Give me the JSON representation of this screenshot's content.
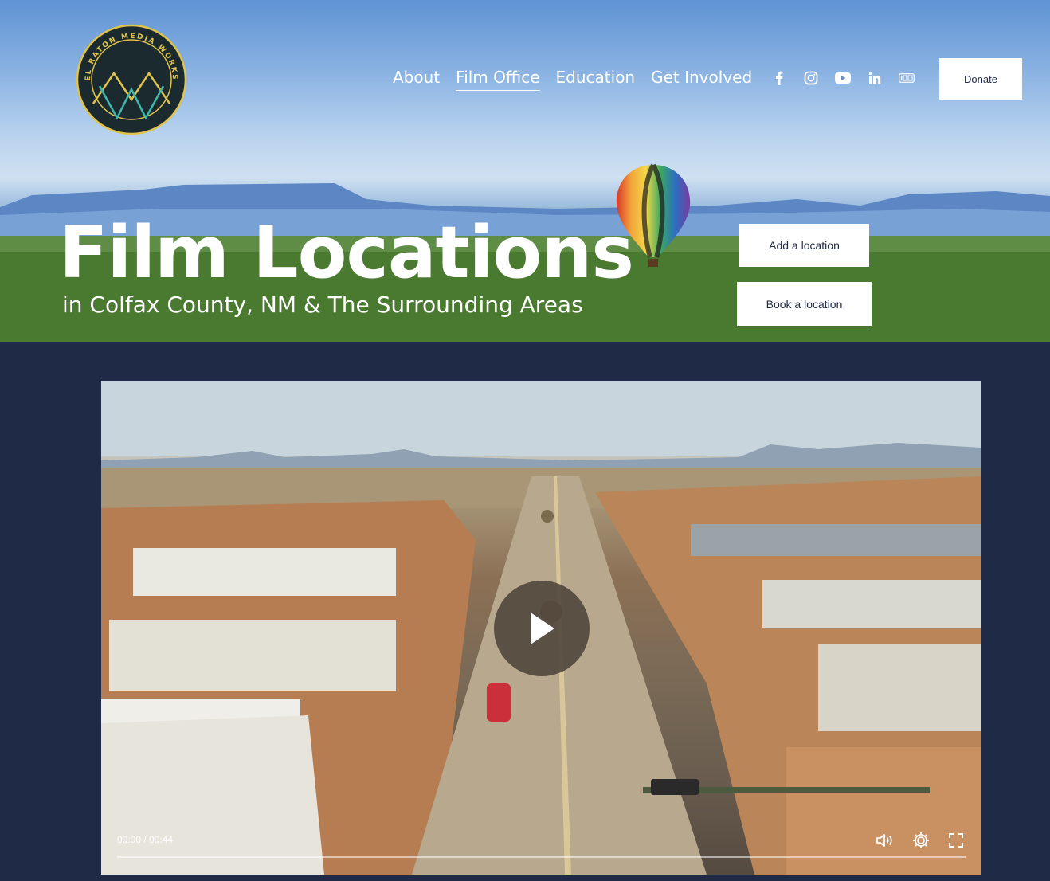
{
  "brand": {
    "logo_text": "EL RATON MEDIA WORKS"
  },
  "nav": {
    "items": [
      {
        "label": "About"
      },
      {
        "label": "Film Office"
      },
      {
        "label": "Education"
      },
      {
        "label": "Get Involved"
      }
    ],
    "active": "Film Office"
  },
  "socials": [
    "facebook-icon",
    "instagram-icon",
    "youtube-icon",
    "linkedin-icon",
    "imdb-icon"
  ],
  "donate_label": "Donate",
  "hero": {
    "title": "Film Locations",
    "subtitle": "in Colfax County, NM & The Surrounding Areas",
    "add_location_label": "Add a location",
    "book_location_label": "Book a location"
  },
  "video": {
    "time_label": "00:00 / 00:44",
    "progress": 0
  },
  "colors": {
    "page_bg": "#1f2a46",
    "logo_bg": "#1b2a2e",
    "logo_ring": "#e2c34a",
    "logo_accent": "#3fb8b0"
  }
}
